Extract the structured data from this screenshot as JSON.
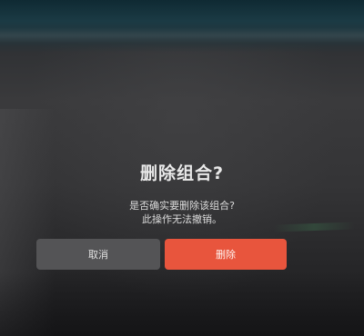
{
  "dialog": {
    "title": "删除组合?",
    "message_line1": "是否确实要删除该组合?",
    "message_line2": "此操作无法撤销。",
    "cancel_label": "取消",
    "delete_label": "删除"
  },
  "colors": {
    "delete_button": "#e8553d",
    "cancel_button": "#545456",
    "background": "#343436"
  }
}
